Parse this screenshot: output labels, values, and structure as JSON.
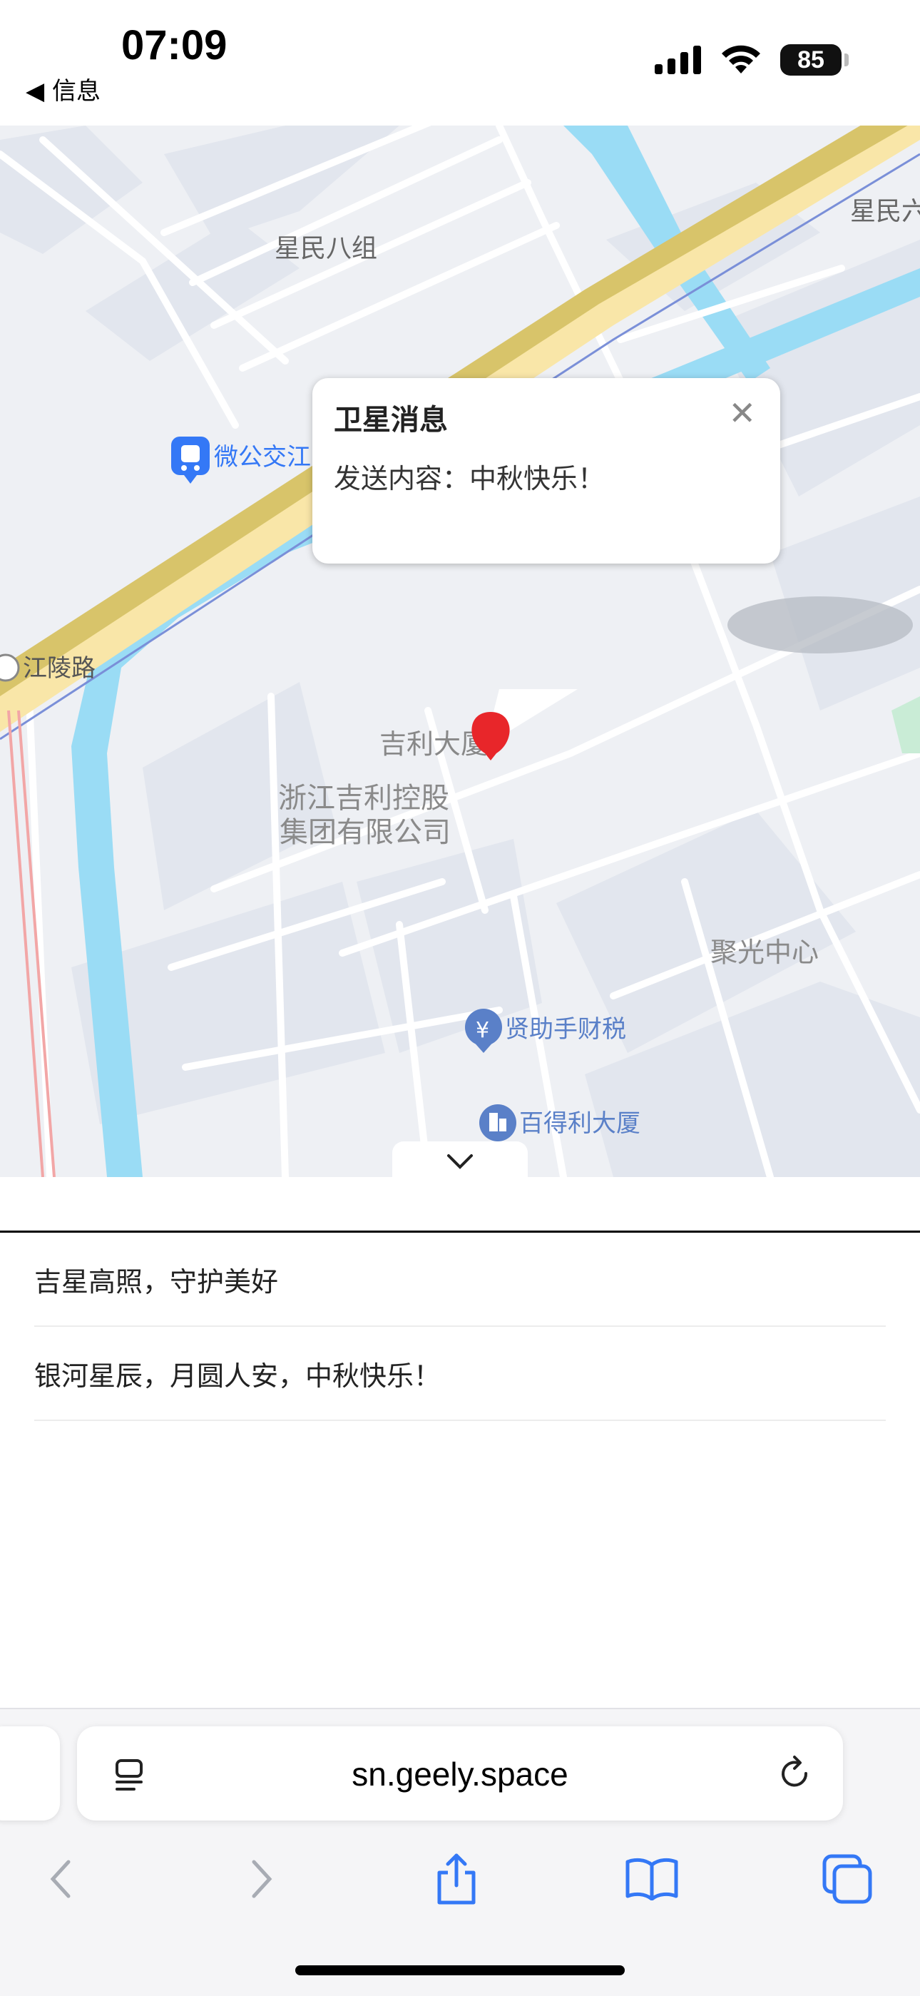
{
  "status_bar": {
    "time": "07:09",
    "back_label": "◀ 信息",
    "battery": "85",
    "icons": [
      "signal-icon",
      "wifi-icon",
      "battery-icon"
    ]
  },
  "map": {
    "labels": {
      "xingmin8": "星民八组",
      "xingmin_edge": "星民六",
      "bus_station": "微公交江陵站",
      "jiangling_road": "江陵路",
      "geely_building": "吉利大厦",
      "geely_holding_1": "浙江吉利控股",
      "geely_holding_2": "集团有限公司",
      "juguang": "聚光中心",
      "xianzhushou": "贤助手财税",
      "baideli": "百得利大厦"
    },
    "popup": {
      "title": "卫星消息",
      "content": "发送内容：中秋快乐！"
    }
  },
  "messages": [
    "吉星高照，守护美好",
    "银河星辰，月圆人安，中秋快乐！"
  ],
  "browser": {
    "url": "sn.geely.space"
  },
  "colors": {
    "water": "#9adcf5",
    "railway": "#d8c46a",
    "road": "#ffffff",
    "block": "#e3e7ef",
    "accent_blue": "#3478f6",
    "pin_red": "#e8262a"
  }
}
